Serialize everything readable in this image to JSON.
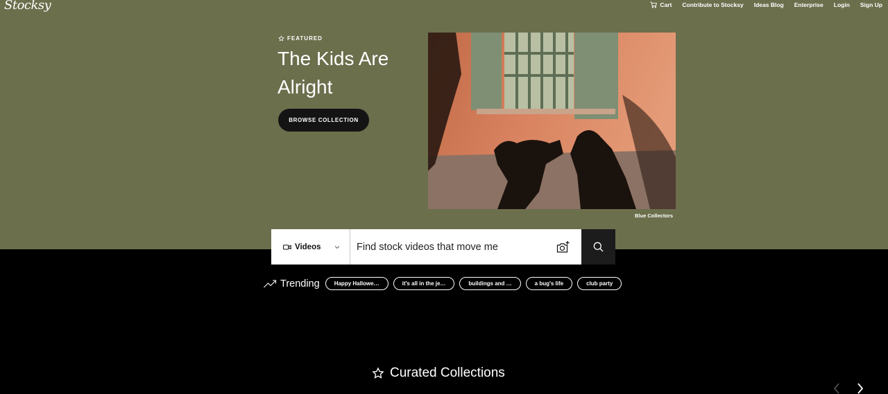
{
  "brand": {
    "logo_text": "Stocksy"
  },
  "nav": {
    "items": [
      {
        "label": "Cart",
        "icon": "cart-icon"
      },
      {
        "label": "Contribute to Stocksy"
      },
      {
        "label": "Ideas Blog"
      },
      {
        "label": "Enterprise"
      },
      {
        "label": "Login"
      },
      {
        "label": "Sign Up"
      }
    ]
  },
  "hero": {
    "featured_label": "FEATURED",
    "title": "The Kids Are Alright",
    "cta_label": "BROWSE COLLECTION",
    "image_credit": "Blue Collectors",
    "background_color": "#6b6f4c"
  },
  "search": {
    "media_type": "Videos",
    "placeholder": "Find stock videos that move me",
    "camera_icon": "camera-plus-icon",
    "search_icon": "search-icon"
  },
  "trending": {
    "label": "Trending",
    "chips": [
      "Happy Hallowe…",
      "it's all in the je…",
      "buildings and …",
      "a bug's life",
      "club party"
    ]
  },
  "curated": {
    "title": "Curated Collections"
  }
}
